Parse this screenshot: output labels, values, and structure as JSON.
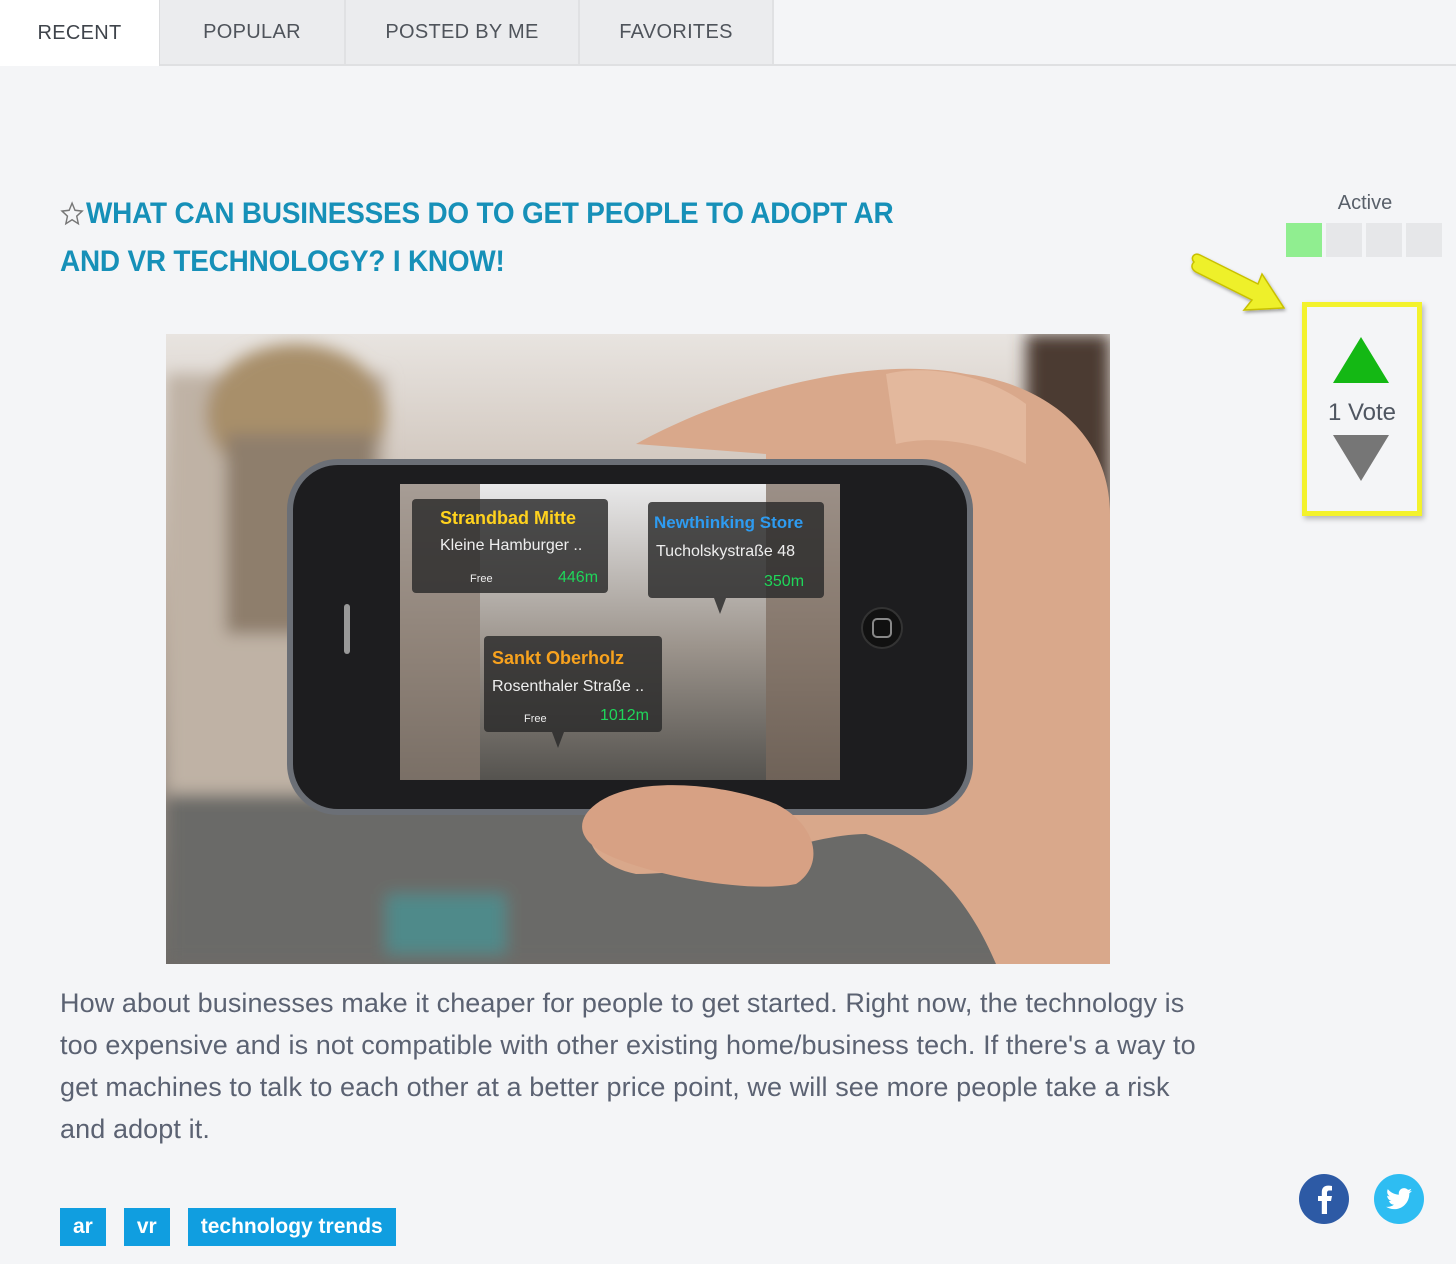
{
  "tabs": [
    {
      "label": "RECENT",
      "active": true
    },
    {
      "label": "POPULAR",
      "active": false
    },
    {
      "label": "POSTED BY ME",
      "active": false
    },
    {
      "label": "FAVORITES",
      "active": false
    }
  ],
  "post": {
    "favorite_icon": "star-outline-icon",
    "title": "WHAT CAN BUSINESSES DO TO GET PEOPLE TO ADOPT AR AND VR TECHNOLOGY? I KNOW!",
    "image": {
      "description": "Hand holding smartphone showing augmented reality street view with location labels",
      "overlays": [
        {
          "name": "Strandbad Mitte",
          "address": "Kleine Hamburger ..",
          "wifi": "Free",
          "distance": "446m",
          "color": "#ffd21e"
        },
        {
          "name": "Newthinking Store",
          "address": "Tucholskystraße 48",
          "wifi": "",
          "distance": "350m",
          "color": "#2e9bf0"
        },
        {
          "name": "Sankt Oberholz",
          "address": "Rosenthaler Straße ..",
          "wifi": "Free",
          "distance": "1012m",
          "color": "#f7a21e"
        }
      ]
    },
    "body": "How about businesses make it cheaper for people to get started. Right now, the technology is too expensive and is not compatible with other existing home/business tech. If there's a way to get machines to talk to each other at a better price point, we will see more people take a risk and adopt it.",
    "tags": [
      "ar",
      "vr",
      "technology trends"
    ]
  },
  "activity": {
    "label": "Active",
    "level": 1,
    "max_level": 4,
    "active_color": "#90ee90",
    "inactive_color": "#e6e7e9"
  },
  "voting": {
    "count_label": "1 Vote",
    "up_color": "#14b814",
    "down_color": "#767676",
    "highlight_color": "#f3f22c"
  },
  "social": [
    {
      "network": "facebook",
      "icon": "facebook-icon",
      "color": "#2d5aa5"
    },
    {
      "network": "twitter",
      "icon": "twitter-icon",
      "color": "#2ebdf2"
    }
  ]
}
